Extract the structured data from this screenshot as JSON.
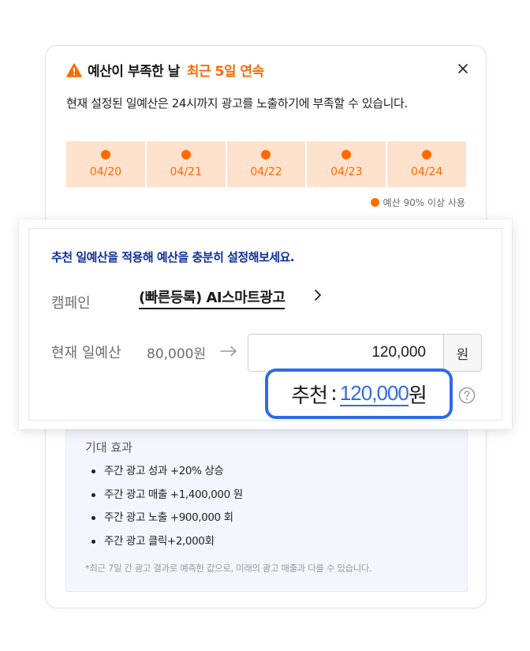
{
  "alert": {
    "title": "예산이 부족한 날",
    "title_accent": "최근 5일 연속",
    "description": "현재 설정된 일예산은 24시까지 광고를 노출하기에 부족할 수 있습니다.",
    "days": [
      "04/20",
      "04/21",
      "04/22",
      "04/23",
      "04/24"
    ],
    "legend": "예산 90% 이상 사용",
    "accent_color": "#ff6a00",
    "close_icon": "close-icon",
    "warning_icon": "warning-triangle-icon"
  },
  "recommend": {
    "headline": "추천 일예산을 적용해 예산을 충분히 설정해보세요.",
    "campaign_label": "캠페인",
    "campaign_name": "(빠른등록) AI스마트광고",
    "current_label": "현재 일예산",
    "current_value": "80,000원",
    "input_value": "120,000",
    "unit": "원",
    "rec_label": "추천",
    "rec_colon": ":",
    "rec_value": "120,000",
    "rec_unit": "원",
    "highlight_color": "#2f6be6"
  },
  "expected": {
    "title": "기대 효과",
    "items": [
      "주간 광고 성과 +20% 상승",
      "주간 광고 매출 +1,400,000 원",
      "주간 광고 노출 +900,000 회",
      "주간 광고 클릭+2,000회"
    ],
    "note": "*최근 7일 간 광고 결과로 예측한 값으로, 미래의 광고 매출과 다를 수 있습니다."
  }
}
